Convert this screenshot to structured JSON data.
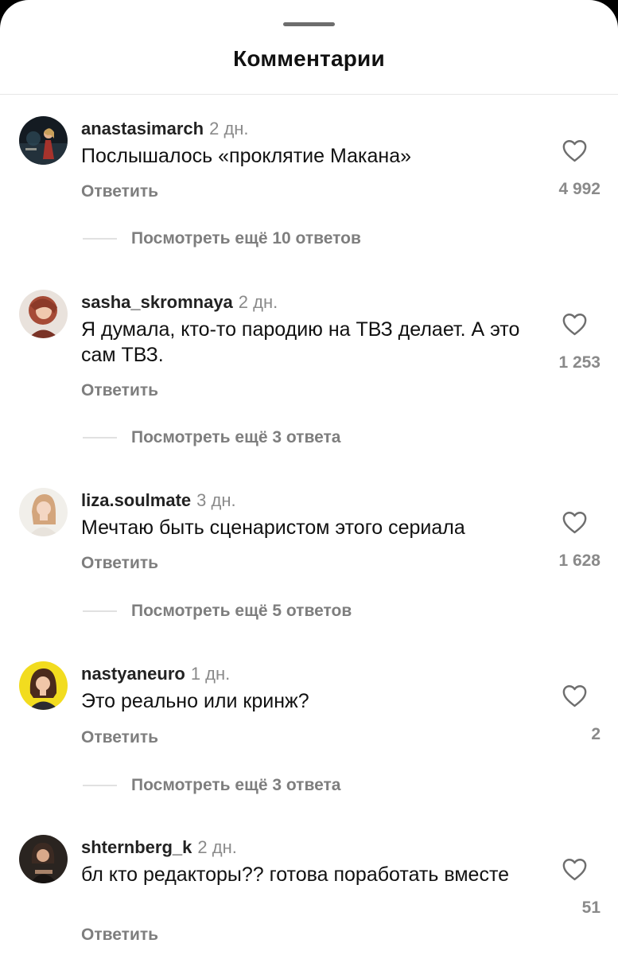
{
  "header": {
    "title": "Комментарии"
  },
  "comments": [
    {
      "username": "anastasimarch",
      "age": "2 дн.",
      "text": "Послышалось «проклятие Макана»",
      "reply_label": "Ответить",
      "likes": "4 992",
      "more_label": "Посмотреть ещё 10 ответов"
    },
    {
      "username": "sasha_skromnaya",
      "age": "2 дн.",
      "text": "Я думала, кто-то пародию на ТВЗ делает. А это сам ТВЗ.",
      "reply_label": "Ответить",
      "likes": "1 253",
      "more_label": "Посмотреть ещё 3 ответа"
    },
    {
      "username": "liza.soulmate",
      "age": "3 дн.",
      "text": "Мечтаю быть сценаристом этого сериала",
      "reply_label": "Ответить",
      "likes": "1 628",
      "more_label": "Посмотреть ещё 5 ответов"
    },
    {
      "username": "nastyaneuro",
      "age": "1 дн.",
      "text": "Это реально или кринж?",
      "reply_label": "Ответить",
      "likes": "2",
      "more_label": "Посмотреть ещё 3 ответа"
    },
    {
      "username": "shternberg_k",
      "age": "2 дн.",
      "text": "бл кто редакторы?? готова поработать вместе",
      "reply_label": "Ответить",
      "likes": "51",
      "more_label": ""
    }
  ],
  "icons": {
    "like": "heart-outline-icon",
    "drag_handle": "grabber-bar"
  },
  "colors": {
    "background": "#ffffff",
    "text_primary": "#111111",
    "text_secondary": "#8a8a8a",
    "divider": "#e1e1e1"
  }
}
